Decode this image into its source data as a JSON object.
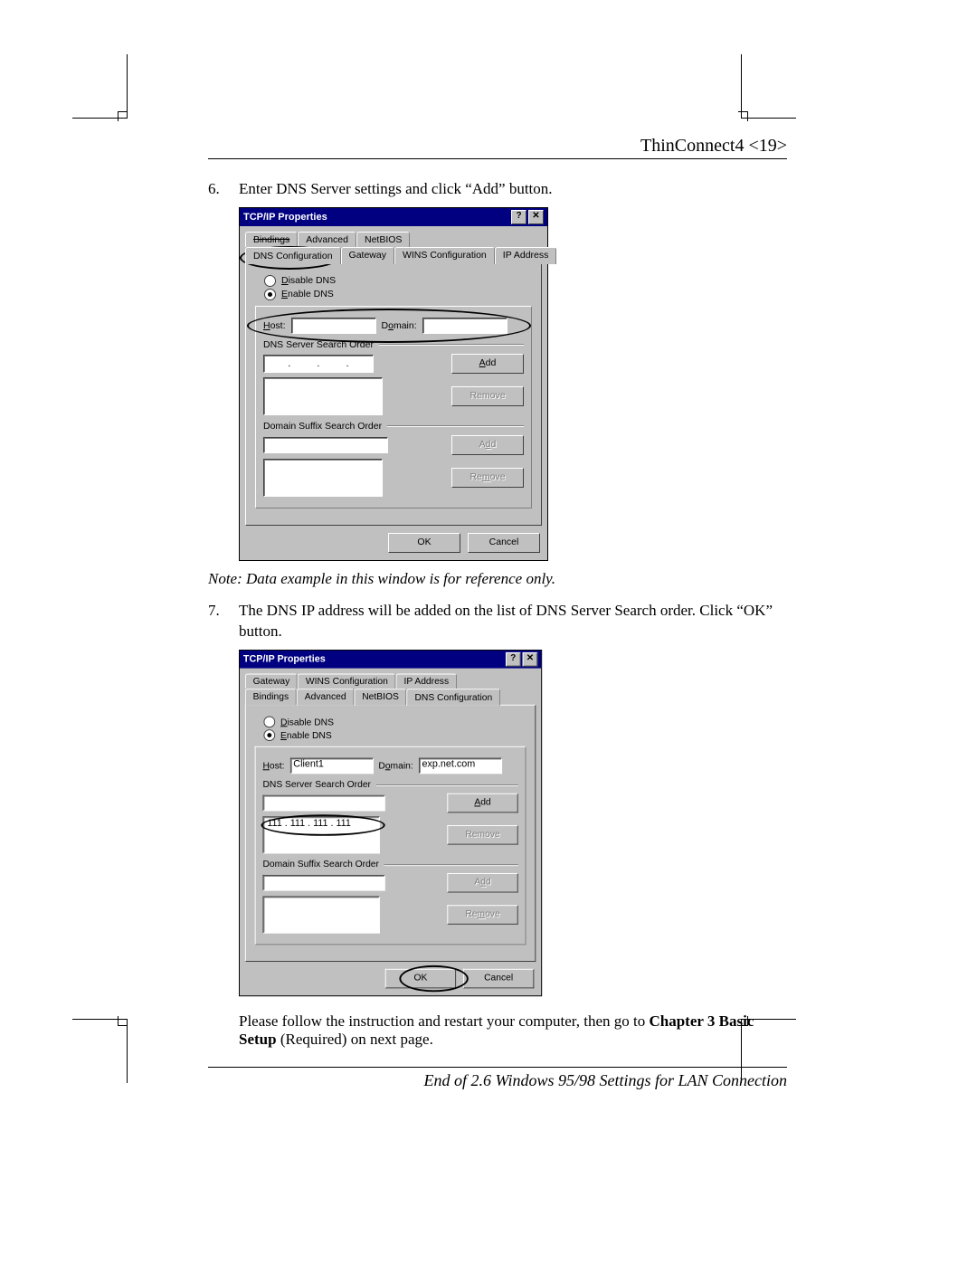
{
  "header": "ThinConnect4 <19>",
  "steps": {
    "s6": {
      "num": "6.",
      "text": "Enter DNS Server settings and click “Add” button."
    },
    "s7": {
      "num": "7.",
      "text": "The DNS IP address will be added on the list of DNS Server Search order. Click “OK” button."
    }
  },
  "note": "Note: Data example in this window is for reference only.",
  "follow": {
    "lead": "Please follow the instruction and restart your computer, then go to ",
    "bold": "Chapter 3 Basic Setup",
    "tail": " (Required) on next page."
  },
  "endline": "End of 2.6 Windows 95/98 Settings for LAN Connection",
  "dialog": {
    "title": "TCP/IP Properties",
    "help_glyph": "?",
    "close_glyph": "✕",
    "tabs": {
      "bindings": "Bindings",
      "advanced": "Advanced",
      "netbios": "NetBIOS",
      "dnsconf": "DNS Configuration",
      "gateway": "Gateway",
      "winsconf": "WINS Configuration",
      "ipaddr": "IP Address"
    },
    "radios": {
      "disable": "Disable DNS",
      "enable": "Enable DNS"
    },
    "labels": {
      "host": "Host:",
      "domain": "Domain:",
      "dns_order": "DNS Server Search Order",
      "suffix_order": "Domain Suffix Search Order"
    },
    "buttons": {
      "add": "Add",
      "remove": "Remove",
      "ok": "OK",
      "cancel": "Cancel"
    }
  },
  "dialog2": {
    "host_value": "Client1",
    "domain_value": "exp.net.com",
    "dns_entry": "111 . 111 . 111 . 111"
  }
}
